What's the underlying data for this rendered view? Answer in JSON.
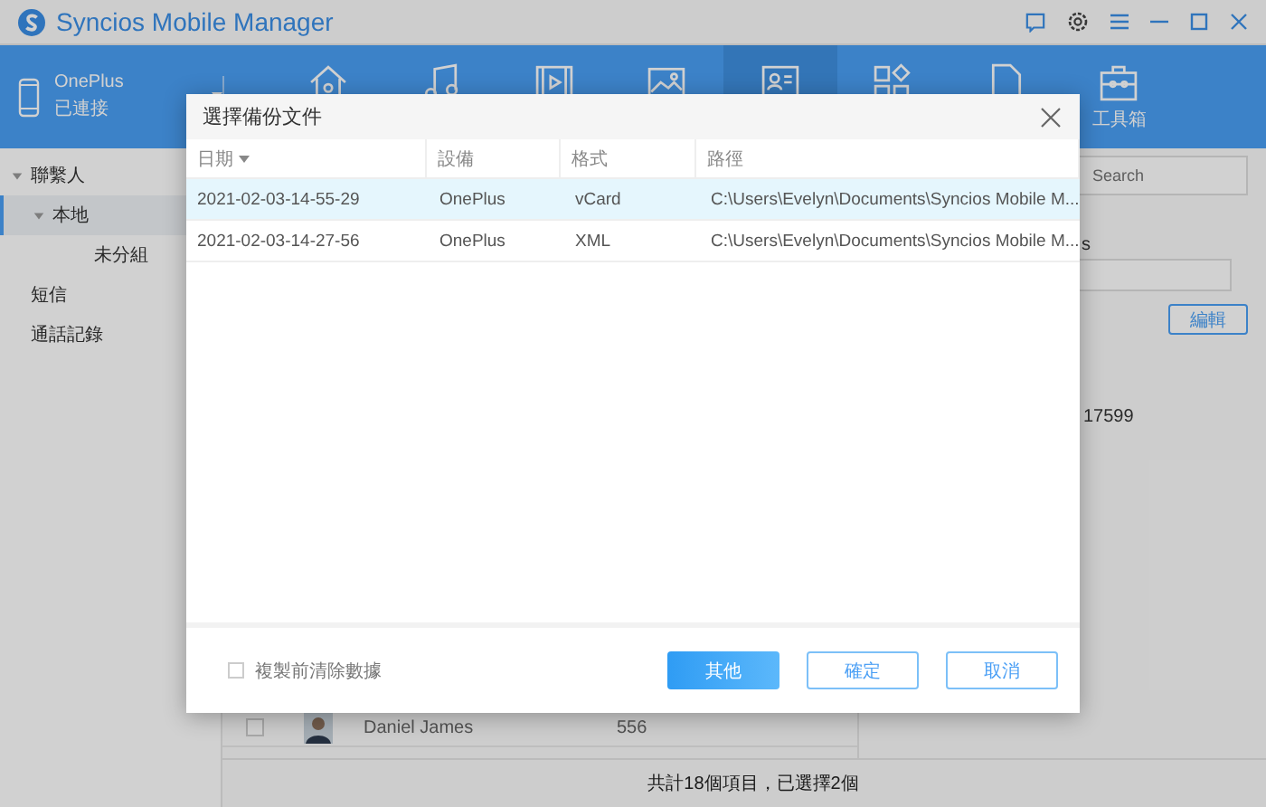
{
  "window": {
    "title": "Syncios Mobile Manager"
  },
  "device": {
    "name": "OnePlus",
    "status": "已連接"
  },
  "nav": [
    {
      "kind": "home",
      "selected": false
    },
    {
      "kind": "music",
      "selected": false
    },
    {
      "kind": "video",
      "selected": false
    },
    {
      "kind": "photo",
      "selected": false
    },
    {
      "kind": "contacts",
      "selected": true
    },
    {
      "kind": "apps",
      "selected": false
    },
    {
      "kind": "files",
      "selected": false
    },
    {
      "kind": "toolbox",
      "selected": false,
      "label": "工具箱"
    }
  ],
  "sidebar": {
    "items": [
      {
        "label": "聯繫人",
        "expanded": true,
        "selected": false,
        "children": [
          {
            "label": "本地",
            "expanded": true,
            "selected": true,
            "children": [
              {
                "label": "未分組",
                "selected": false
              }
            ]
          }
        ]
      },
      {
        "label": "短信",
        "selected": false
      },
      {
        "label": "通話記錄",
        "selected": false
      }
    ]
  },
  "contacts": {
    "rows": [
      {
        "name": "Daniel James",
        "phone": "556",
        "checked": false
      }
    ]
  },
  "detail": {
    "search": {
      "placeholder": "Search"
    },
    "label_fragment": "s",
    "edit_button": "編輯",
    "phone_fragment": "17599"
  },
  "status_bar": "共計18個項目，已選擇2個",
  "dialog": {
    "title": "選擇備份文件",
    "columns": [
      {
        "label": "日期",
        "sorted": true
      },
      {
        "label": "設備",
        "sorted": false
      },
      {
        "label": "格式",
        "sorted": false
      },
      {
        "label": "路徑",
        "sorted": false
      }
    ],
    "rows": [
      {
        "cells": [
          "2021-02-03-14-55-29",
          "OnePlus",
          "vCard",
          "C:\\Users\\Evelyn\\Documents\\Syncios Mobile M..."
        ],
        "selected": true
      },
      {
        "cells": [
          "2021-02-03-14-27-56",
          "OnePlus",
          "XML",
          "C:\\Users\\Evelyn\\Documents\\Syncios Mobile M..."
        ],
        "selected": false
      }
    ],
    "clear_before_copy": {
      "label": "複製前清除數據",
      "checked": false
    },
    "buttons": [
      {
        "label": "其他",
        "kind": "primary"
      },
      {
        "label": "確定",
        "kind": "secondary"
      },
      {
        "label": "取消",
        "kind": "secondary"
      }
    ]
  }
}
